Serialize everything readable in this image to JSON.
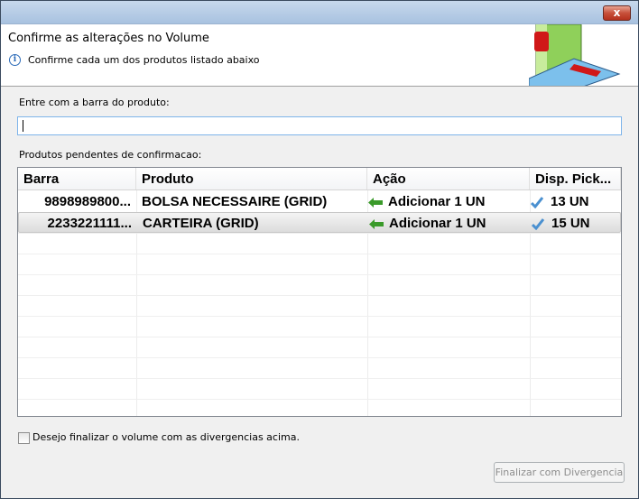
{
  "window": {
    "close_label": "x"
  },
  "header": {
    "title": "Confirme as alterações no Volume",
    "subtitle": "Confirme cada um dos produtos listado abaixo"
  },
  "barcode": {
    "label": "Entre com a barra do produto:",
    "value": ""
  },
  "pending": {
    "label": "Produtos pendentes de confirmacao:"
  },
  "table": {
    "columns": [
      "Barra",
      "Produto",
      "Ação",
      "Disp. Pick..."
    ],
    "rows": [
      {
        "barra": "9898989800...",
        "produto": "BOLSA NECESSAIRE (GRID)",
        "acao": "Adicionar 1 UN",
        "disp": "13 UN",
        "selected": false
      },
      {
        "barra": "2233221111...",
        "produto": "CARTEIRA (GRID)",
        "acao": "Adicionar 1 UN",
        "disp": "15 UN",
        "selected": true
      }
    ]
  },
  "finalize_checkbox": {
    "label": "Desejo finalizar o volume com as divergencias acima.",
    "checked": false
  },
  "finalize_button": {
    "label": "Finalizar com Divergencia",
    "enabled": false
  }
}
